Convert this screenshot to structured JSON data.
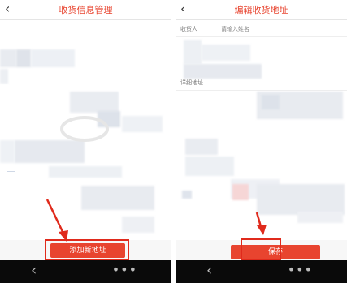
{
  "left_screen": {
    "header": {
      "title": "收货信息管理"
    },
    "add_button_label": "添加新地址"
  },
  "right_screen": {
    "header": {
      "title": "编辑收货地址"
    },
    "fields": {
      "consignee_label": "收货人",
      "consignee_placeholder": "请输入姓名",
      "address_label": "详细地址"
    },
    "save_button_label": "保存"
  },
  "colors": {
    "accent": "#e8442f",
    "highlight": "#e02a1c",
    "navbar": "#0a0a0a"
  },
  "icons": [
    "back-icon",
    "chevron-left-icon",
    "more-icon"
  ]
}
